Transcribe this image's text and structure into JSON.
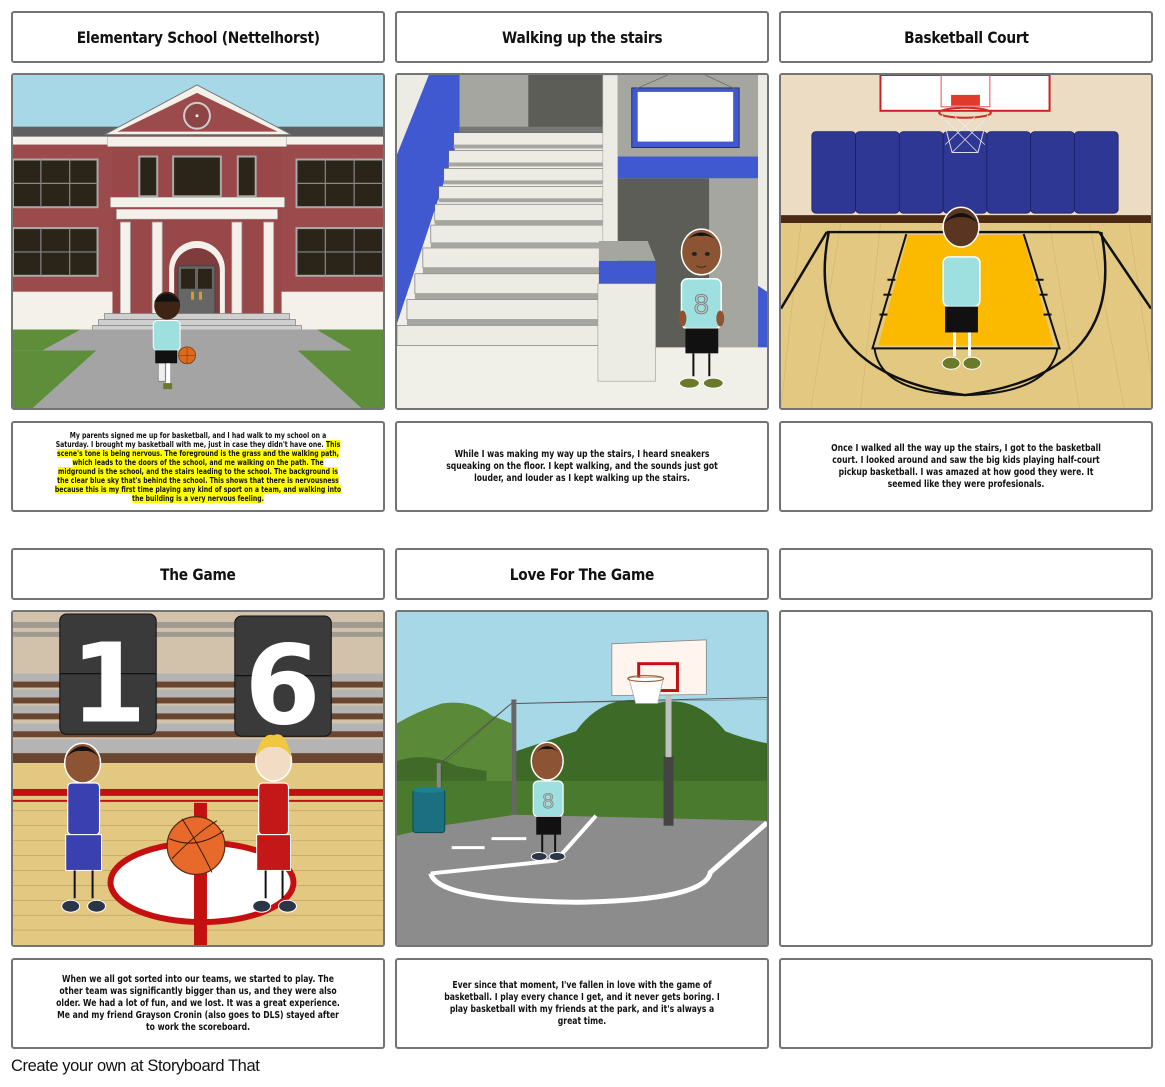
{
  "storyboard": {
    "cells": [
      {
        "title": "Elementary School (Nettelhorst)",
        "scene": "school-exterior",
        "description_plain": "My parents signed me up for basketball, and I had walk to my school on a Saturday. I brought my basketball with me, just in case they didn't have one. ",
        "description_highlight": "This scene's tone is being nervous. The foreground is the grass and the walking path, which leads to the doors of the school, and me walking on the path.  The midground is the school, and the stairs leading to the school. The background is the clear blue sky that's behind the school.  This shows that there is nervousness because this is my first time playing any kind of sport on a team, and walking into the building is a very nervous feeling."
      },
      {
        "title": "Walking up the stairs",
        "scene": "staircase",
        "jersey_number": "8",
        "description": "While I was making my way up the stairs, I heard sneakers squeaking on the floor. I kept walking, and the sounds just got louder, and louder as I kept walking up the stairs."
      },
      {
        "title": "Basketball Court",
        "scene": "indoor-gym",
        "description": "Once I walked all the way up the stairs, I got to the basketball court. I looked around and saw the big kids playing half-court pickup basketball. I was amazed at how good they were. It seemed like they were profesionals."
      },
      {
        "title": "The Game",
        "scene": "scoreboard-game",
        "score_left": "1",
        "score_right": "6",
        "description": "When we all got sorted into our teams, we started to play. The other team was significantly bigger than us, and they were also older. We had a lot of fun, and we lost. It was a great experience. Me and my friend Grayson Cronin (also goes to DLS) stayed after to work the scoreboard."
      },
      {
        "title": "Love For The Game",
        "scene": "outdoor-park-court",
        "jersey_number": "8",
        "description": "Ever since that moment, I've fallen in love with the game of basketball. I play every chance I get, and it never gets boring. I play basketball with my friends at the park, and it's always a great time."
      },
      {
        "title": "",
        "scene": "empty",
        "description": ""
      }
    ]
  },
  "footer": {
    "link_text": "Create your own at Storyboard That"
  },
  "colors": {
    "border": "#747474",
    "highlight": "#ffff00",
    "sky": "#a7d8e8",
    "brick": "#9b4b4b",
    "gym_blue": "#2f3794",
    "court_yellow": "#fbb900",
    "stairs_blue": "#4058d0"
  }
}
